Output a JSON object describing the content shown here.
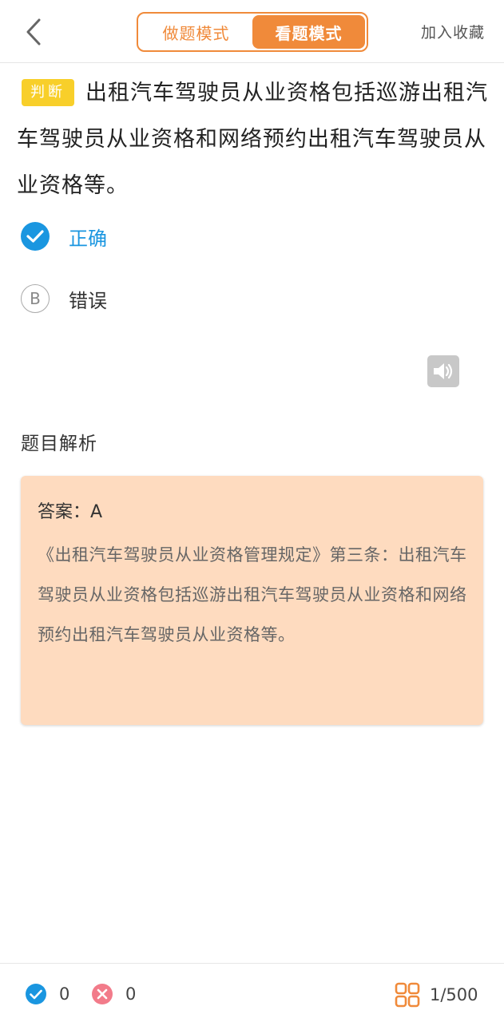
{
  "header": {
    "back_icon": "chevron-left-icon",
    "modes": [
      {
        "label": "做题模式",
        "active": false
      },
      {
        "label": "看题模式",
        "active": true
      }
    ],
    "favorite_label": "加入收藏"
  },
  "question": {
    "type_tag": "判断",
    "text": "出租汽车驾驶员从业资格包括巡游出租汽车驾驶员从业资格和网络预约出租汽车驾驶员从业资格等。"
  },
  "options": [
    {
      "letter": "A",
      "label": "正确",
      "state": "correct",
      "icon": "check-circle-icon"
    },
    {
      "letter": "B",
      "label": "错误",
      "state": "default"
    }
  ],
  "audio_icon": "speaker-icon",
  "analysis": {
    "title": "题目解析",
    "answer": "答案：A",
    "explanation": "《出租汽车驾驶员从业资格管理规定》第三条：出租汽车驾驶员从业资格包括巡游出租汽车驾驶员从业资格和网络预约出租汽车驾驶员从业资格等。"
  },
  "footer": {
    "correct_count": "0",
    "wrong_count": "0",
    "progress": "1/500",
    "grid_icon": "grid-icon"
  },
  "colors": {
    "accent": "#f08a3a",
    "correct": "#1a96e0",
    "wrong": "#f27b8a",
    "tag": "#f8cf2a",
    "analysis_bg": "#fedbbf"
  }
}
